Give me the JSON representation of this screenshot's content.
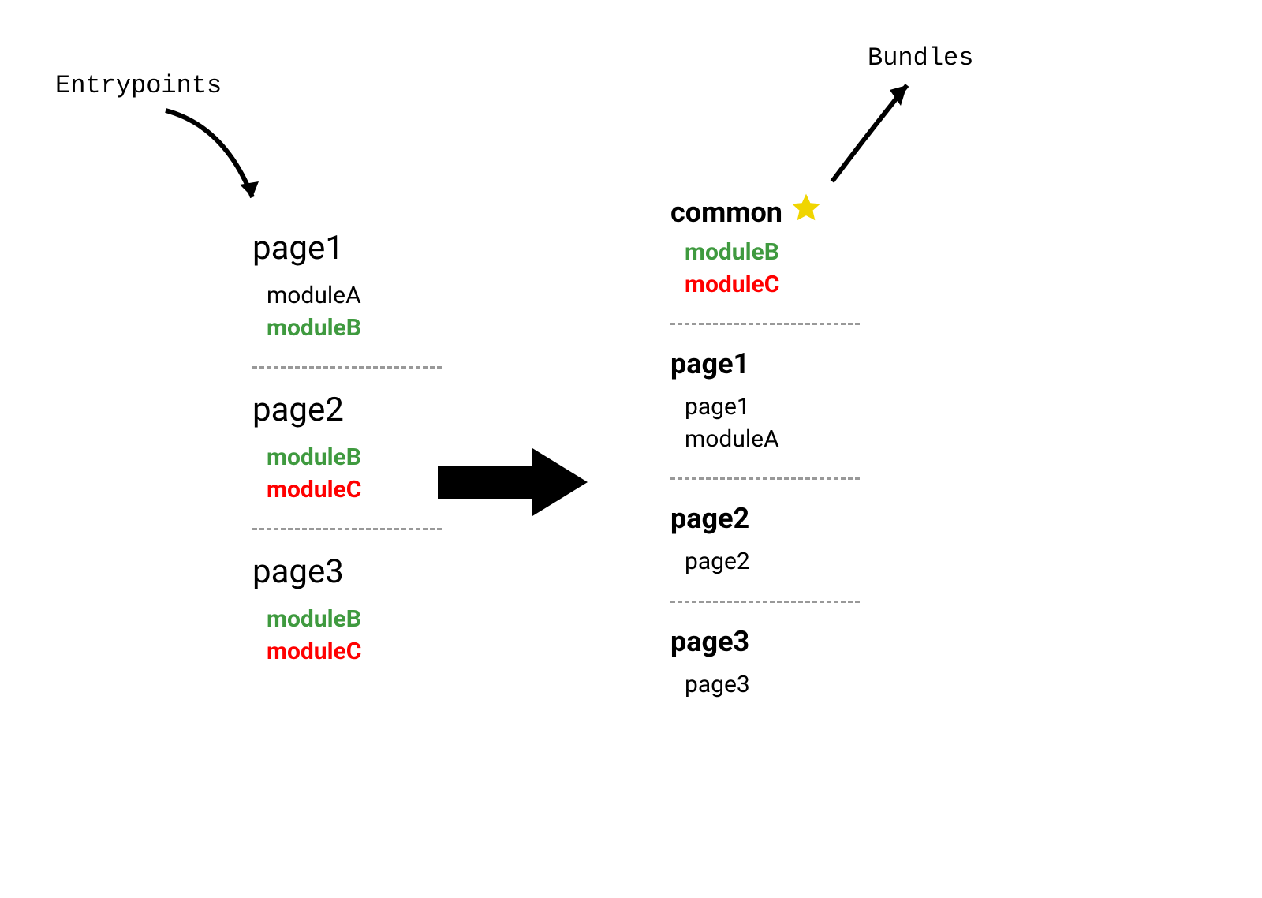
{
  "labels": {
    "entrypoints": "Entrypoints",
    "bundles": "Bundles"
  },
  "entrypoints": [
    {
      "name": "page1",
      "modules": [
        {
          "text": "moduleA",
          "cls": ""
        },
        {
          "text": "moduleB",
          "cls": "green bold"
        }
      ]
    },
    {
      "name": "page2",
      "modules": [
        {
          "text": "moduleB",
          "cls": "green bold"
        },
        {
          "text": "moduleC",
          "cls": "red bold"
        }
      ]
    },
    {
      "name": "page3",
      "modules": [
        {
          "text": "moduleB",
          "cls": "green bold"
        },
        {
          "text": "moduleC",
          "cls": "red bold"
        }
      ]
    }
  ],
  "bundles": [
    {
      "name": "common",
      "starred": true,
      "modules": [
        {
          "text": "moduleB",
          "cls": "green bold"
        },
        {
          "text": "moduleC",
          "cls": "red bold"
        }
      ]
    },
    {
      "name": "page1",
      "starred": false,
      "modules": [
        {
          "text": "page1",
          "cls": ""
        },
        {
          "text": "moduleA",
          "cls": ""
        }
      ]
    },
    {
      "name": "page2",
      "starred": false,
      "modules": [
        {
          "text": "page2",
          "cls": ""
        }
      ]
    },
    {
      "name": "page3",
      "starred": false,
      "modules": [
        {
          "text": "page3",
          "cls": ""
        }
      ]
    }
  ],
  "colors": {
    "green": "#3f9a3f",
    "red": "#ff0000",
    "star": "#f0d500"
  }
}
